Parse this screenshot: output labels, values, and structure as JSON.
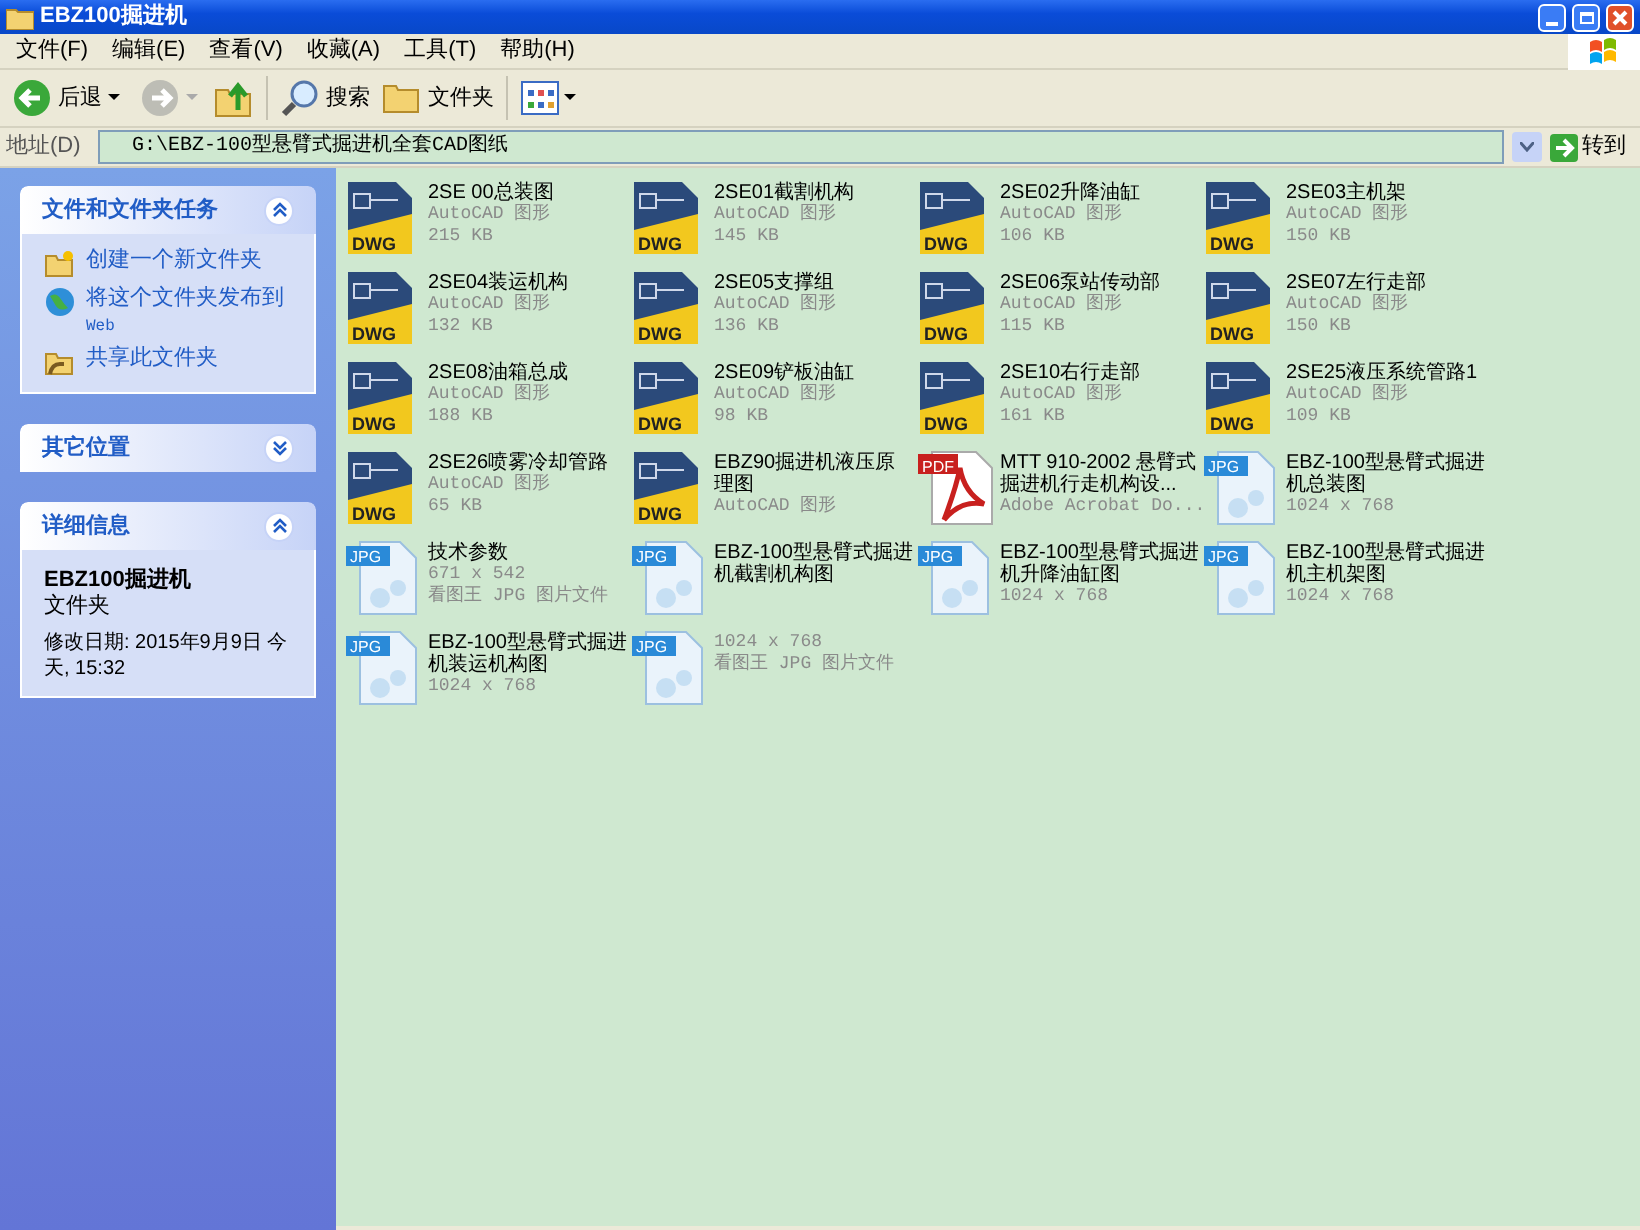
{
  "window": {
    "title": "EBZ100掘进机"
  },
  "menu": [
    "文件(F)",
    "编辑(E)",
    "查看(V)",
    "收藏(A)",
    "工具(T)",
    "帮助(H)"
  ],
  "toolbar": {
    "back": "后退",
    "search": "搜索",
    "folders": "文件夹"
  },
  "address": {
    "label": "地址(D)",
    "value": "G:\\EBZ-100型悬臂式掘进机全套CAD图纸",
    "go": "转到"
  },
  "panels": [
    {
      "title": "文件和文件夹任务",
      "expanded": true,
      "kind": "tasks",
      "items": [
        {
          "kind": "new-folder",
          "label": "创建一个新文件夹"
        },
        {
          "kind": "publish",
          "label": "将这个文件夹发布到",
          "sub": "Web"
        },
        {
          "kind": "share",
          "label": "共享此文件夹"
        }
      ]
    },
    {
      "title": "其它位置",
      "expanded": false
    },
    {
      "title": "详细信息",
      "expanded": true,
      "kind": "details",
      "name": "EBZ100掘进机",
      "type": "文件夹",
      "modified": "修改日期: 2015年9月9日 今天, 15:32"
    }
  ],
  "files": [
    {
      "kind": "dwg",
      "badge": "DWG",
      "name": "2SE 00总装图",
      "lines": [
        "AutoCAD 图形",
        "215 KB"
      ]
    },
    {
      "kind": "dwg",
      "badge": "DWG",
      "name": "2SE01截割机构",
      "lines": [
        "AutoCAD 图形",
        "145 KB"
      ]
    },
    {
      "kind": "dwg",
      "badge": "DWG",
      "name": "2SE02升降油缸",
      "lines": [
        "AutoCAD 图形",
        "106 KB"
      ]
    },
    {
      "kind": "dwg",
      "badge": "DWG",
      "name": "2SE03主机架",
      "lines": [
        "AutoCAD 图形",
        "150 KB"
      ]
    },
    {
      "kind": "dwg",
      "badge": "DWG",
      "name": "2SE04装运机构",
      "lines": [
        "AutoCAD 图形",
        "132 KB"
      ]
    },
    {
      "kind": "dwg",
      "badge": "DWG",
      "name": "2SE05支撑组",
      "lines": [
        "AutoCAD 图形",
        "136 KB"
      ]
    },
    {
      "kind": "dwg",
      "badge": "DWG",
      "name": "2SE06泵站传动部",
      "lines": [
        "AutoCAD 图形",
        "115 KB"
      ]
    },
    {
      "kind": "dwg",
      "badge": "DWG",
      "name": "2SE07左行走部",
      "lines": [
        "AutoCAD 图形",
        "150 KB"
      ]
    },
    {
      "kind": "dwg",
      "badge": "DWG",
      "name": "2SE08油箱总成",
      "lines": [
        "AutoCAD 图形",
        "188 KB"
      ]
    },
    {
      "kind": "dwg",
      "badge": "DWG",
      "name": "2SE09铲板油缸",
      "lines": [
        "AutoCAD 图形",
        "98 KB"
      ]
    },
    {
      "kind": "dwg",
      "badge": "DWG",
      "name": "2SE10右行走部",
      "lines": [
        "AutoCAD 图形",
        "161 KB"
      ]
    },
    {
      "kind": "dwg",
      "badge": "DWG",
      "name": "2SE25液压系统管路1",
      "lines": [
        "AutoCAD 图形",
        "109 KB"
      ]
    },
    {
      "kind": "dwg",
      "badge": "DWG",
      "name": "2SE26喷雾冷却管路",
      "lines": [
        "AutoCAD 图形",
        "65 KB"
      ]
    },
    {
      "kind": "dwg",
      "badge": "DWG",
      "name": "EBZ90掘进机液压原理图",
      "lines": [
        "AutoCAD 图形"
      ]
    },
    {
      "kind": "pdf",
      "badge": "PDF",
      "name": "MTT 910-2002 悬臂式掘进机行走机构设...",
      "lines": [
        "Adobe Acrobat Do..."
      ]
    },
    {
      "kind": "jpg",
      "badge": "JPG",
      "name": "EBZ-100型悬臂式掘进机总装图",
      "lines": [
        "1024 x 768"
      ]
    },
    {
      "kind": "jpg",
      "badge": "JPG",
      "name": "技术参数",
      "lines": [
        "671 x 542",
        "看图王 JPG 图片文件"
      ]
    },
    {
      "kind": "jpg",
      "badge": "JPG",
      "name": "EBZ-100型悬臂式掘进机截割机构图"
    },
    {
      "kind": "jpg",
      "badge": "JPG",
      "name": "EBZ-100型悬臂式掘进机升降油缸图",
      "lines": [
        "1024 x 768"
      ]
    },
    {
      "kind": "jpg",
      "badge": "JPG",
      "name": "EBZ-100型悬臂式掘进机主机架图",
      "lines": [
        "1024 x 768"
      ]
    },
    {
      "kind": "jpg",
      "badge": "JPG",
      "name": "EBZ-100型悬臂式掘进机装运机构图",
      "lines": [
        "1024 x 768"
      ]
    },
    {
      "kind": "jpg",
      "badge": "JPG",
      "lines": [
        "1024 x 768",
        "看图王 JPG 图片文件"
      ]
    }
  ]
}
